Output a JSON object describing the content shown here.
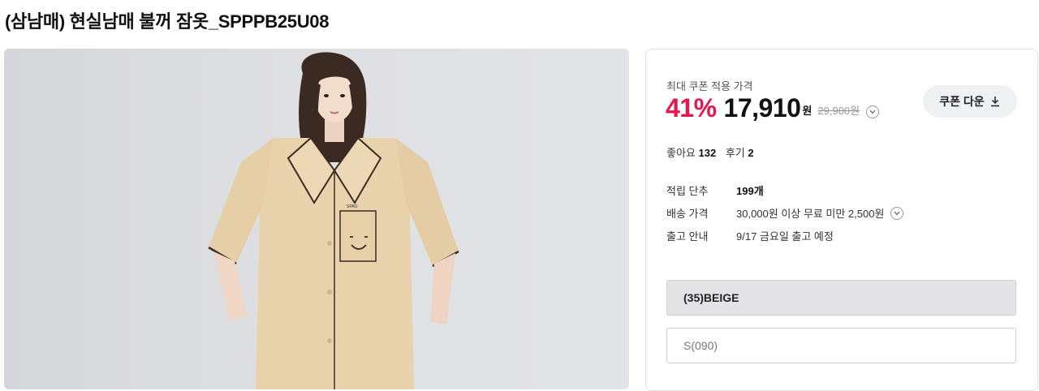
{
  "product": {
    "title": "(삼남매) 현실남매 불꺼 잠옷_SPPPB25U08"
  },
  "image": {
    "alt": "상품 이미지"
  },
  "price": {
    "coupon_caption": "최대 쿠폰 적용 가격",
    "discount": "41%",
    "final_price": "17,910",
    "currency": "원",
    "original_price": "29,900원"
  },
  "coupon_button": {
    "label": "쿠폰 다운"
  },
  "stats": {
    "likes_label": "좋아요",
    "likes_count": "132",
    "reviews_label": "후기",
    "reviews_count": "2"
  },
  "info": [
    {
      "label": "적립 단추",
      "value": "199개"
    },
    {
      "label": "배송 가격",
      "value": "30,000원 이상 무료 미만 2,500원"
    },
    {
      "label": "출고 안내",
      "value": "9/17 금요일 출고 예정"
    }
  ],
  "options": {
    "color": "(35)BEIGE",
    "size": "S(090)"
  },
  "colors": {
    "discount": "#e8174b",
    "shirt": "#e9d3ad",
    "piping": "#3a2a22",
    "background": "#dedfe3"
  }
}
